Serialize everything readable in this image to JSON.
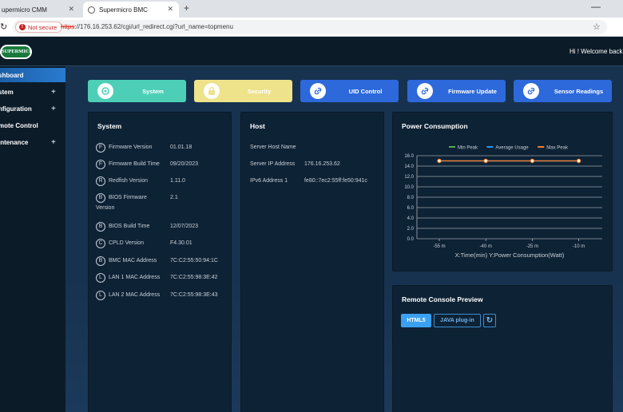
{
  "browser": {
    "tabs": [
      {
        "title": "upermicro CMM"
      },
      {
        "title": "Supermicro BMC"
      }
    ],
    "new_tab_label": "+",
    "not_secure_label": "Not secure",
    "url_scheme": "https",
    "url_rest": "://176.16.253.62/cgi/url_redirect.cgi?url_name=topmenu"
  },
  "header": {
    "logo_text": "SUPERMICRO",
    "welcome": "Hi ! Welcome back !"
  },
  "sidebar": {
    "items": [
      {
        "label": "shboard",
        "expandable": false
      },
      {
        "label": "stem",
        "expandable": true
      },
      {
        "label": "nfiguration",
        "expandable": true
      },
      {
        "label": "mote Control",
        "expandable": false
      },
      {
        "label": "intenance",
        "expandable": true
      }
    ],
    "plus": "+"
  },
  "quick_buttons": [
    {
      "label": "System",
      "color": "#4ccfb6"
    },
    {
      "label": "Security",
      "color": "#eee28b"
    },
    {
      "label": "UID Control",
      "color": "#2d69db"
    },
    {
      "label": "Firmware Update",
      "color": "#2d69db"
    },
    {
      "label": "Sensor Readings",
      "color": "#2d69db"
    }
  ],
  "system": {
    "title": "System",
    "rows": [
      {
        "badge": "F",
        "key": "Firmware Version",
        "value": "01.01.18"
      },
      {
        "badge": "F",
        "key": "Firmware Build Time",
        "value": "09/20/2023"
      },
      {
        "badge": "R",
        "key": "Redfish Version",
        "value": "1.11.0"
      },
      {
        "badge": "B",
        "key": "BIOS Firmware",
        "key2": "Version",
        "value": "2.1"
      },
      {
        "badge": "B",
        "key": "BIOS Build Time",
        "value": "12/07/2023"
      },
      {
        "badge": "C",
        "key": "CPLD Version",
        "value": "F4.30.01"
      },
      {
        "badge": "B",
        "key": "BMC MAC Address",
        "value": "7C:C2:55:50:94:1C"
      },
      {
        "badge": "L",
        "key": "LAN 1 MAC Address",
        "value": "7C:C2:55:98:3E:42"
      },
      {
        "badge": "L",
        "key": "LAN 2 MAC Address",
        "value": "7C:C2:55:98:3E:43"
      }
    ]
  },
  "host": {
    "title": "Host",
    "rows": [
      {
        "key": "Server Host Name",
        "value": ""
      },
      {
        "key": "Server IP Address",
        "value": "176.16.253.62"
      },
      {
        "key": "IPv6 Address 1",
        "value": "fe80::7ec2:55ff:fe50:941c"
      }
    ]
  },
  "power": {
    "title": "Power Consumption"
  },
  "chart_data": {
    "type": "line",
    "title": "",
    "xlabel": "X:Time(min) Y:Power Consumption(Watt)",
    "ylabel": "",
    "categories": [
      "-55 m",
      "-40 m",
      "-25 m",
      "-10 m"
    ],
    "ylim": [
      0,
      16
    ],
    "yticks": [
      "0.0",
      "2.0",
      "4.0",
      "6.0",
      "8.0",
      "10.0",
      "12.0",
      "14.0",
      "16.0"
    ],
    "grid": true,
    "legend_placement": "top",
    "series": [
      {
        "name": "Min Peak",
        "color": "#4caf50",
        "values": [
          15,
          15,
          15,
          15
        ]
      },
      {
        "name": "Average Usage",
        "color": "#2196f3",
        "values": [
          15,
          15,
          15,
          15
        ]
      },
      {
        "name": "Max Peak",
        "color": "#ff7a2e",
        "values": [
          15,
          15,
          15,
          15
        ]
      }
    ]
  },
  "console": {
    "title": "Remote Console Preview",
    "html5_label": "HTML5",
    "java_label": "JAVA plug-in",
    "refresh_icon": "refresh-icon"
  }
}
